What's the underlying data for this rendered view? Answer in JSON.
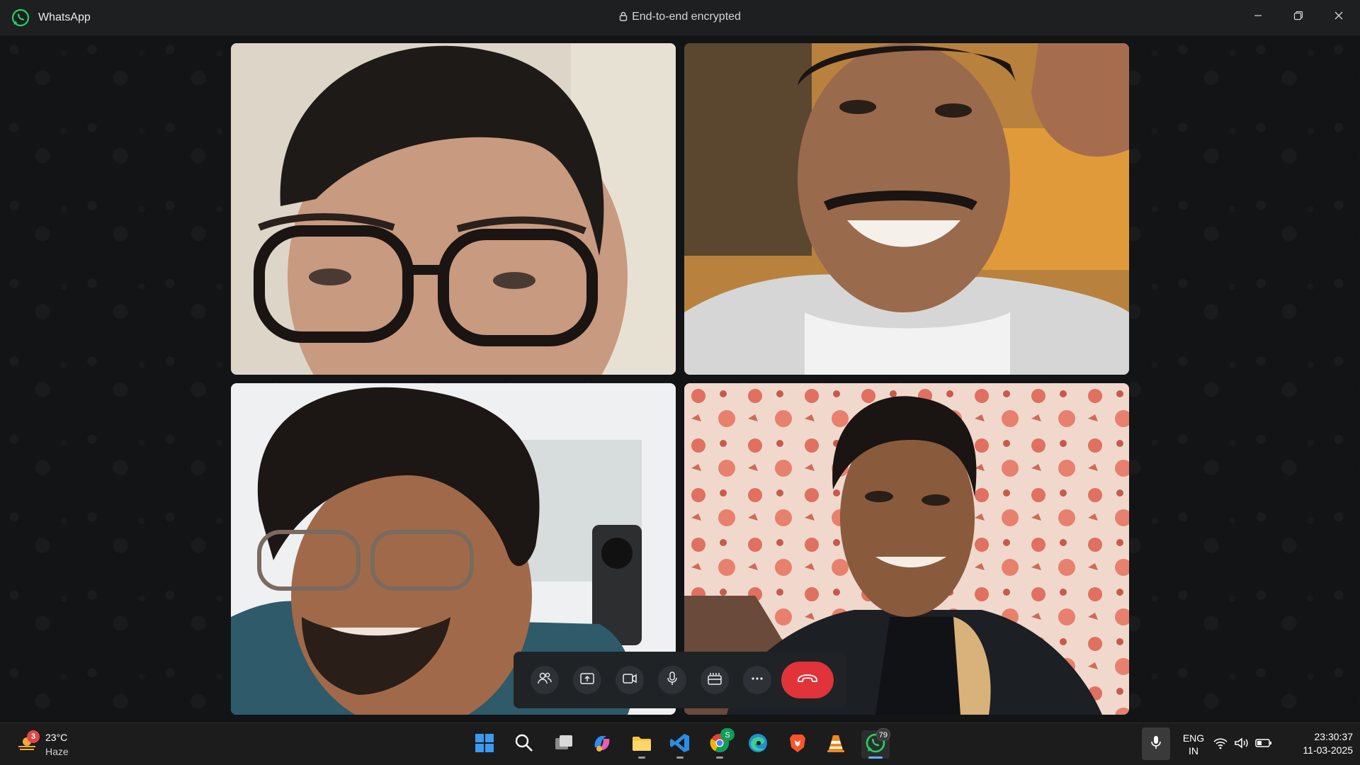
{
  "window": {
    "app_name": "WhatsApp",
    "encryption_label": "End-to-end encrypted",
    "icons": [
      "whatsapp-logo",
      "lock-icon",
      "minimize-icon",
      "restore-icon",
      "close-icon"
    ]
  },
  "call": {
    "participants": [
      {
        "id": "participant-1",
        "tile": "video"
      },
      {
        "id": "participant-2",
        "tile": "video"
      },
      {
        "id": "participant-3",
        "tile": "video"
      },
      {
        "id": "participant-4",
        "tile": "video"
      }
    ],
    "controls": [
      {
        "name": "participants-button",
        "icon": "people-icon"
      },
      {
        "name": "share-screen-button",
        "icon": "share-screen-icon"
      },
      {
        "name": "camera-button",
        "icon": "video-camera-icon"
      },
      {
        "name": "microphone-button",
        "icon": "microphone-icon"
      },
      {
        "name": "effects-button",
        "icon": "effects-icon"
      },
      {
        "name": "more-options-button",
        "icon": "more-icon"
      },
      {
        "name": "end-call-button",
        "icon": "end-call-icon"
      }
    ],
    "colors": {
      "end_call": "#e0333a",
      "accent": "#25d366"
    }
  },
  "taskbar": {
    "weather": {
      "badge": "3",
      "temperature": "23°C",
      "condition": "Haze"
    },
    "apps": [
      {
        "name": "start",
        "icon": "windows-icon"
      },
      {
        "name": "search",
        "icon": "search-icon"
      },
      {
        "name": "task-view",
        "icon": "task-view-icon"
      },
      {
        "name": "copilot",
        "icon": "copilot-icon"
      },
      {
        "name": "file-explorer",
        "icon": "folder-icon"
      },
      {
        "name": "vscode",
        "icon": "vscode-icon"
      },
      {
        "name": "chrome",
        "icon": "chrome-icon",
        "badge": "S"
      },
      {
        "name": "edge",
        "icon": "edge-icon"
      },
      {
        "name": "brave",
        "icon": "brave-icon"
      },
      {
        "name": "vlc",
        "icon": "vlc-icon"
      },
      {
        "name": "whatsapp",
        "icon": "whatsapp-icon",
        "badge": "79"
      }
    ],
    "language": {
      "line1": "ENG",
      "line2": "IN"
    },
    "clock": {
      "time": "23:30:37",
      "date": "11-03-2025"
    }
  }
}
